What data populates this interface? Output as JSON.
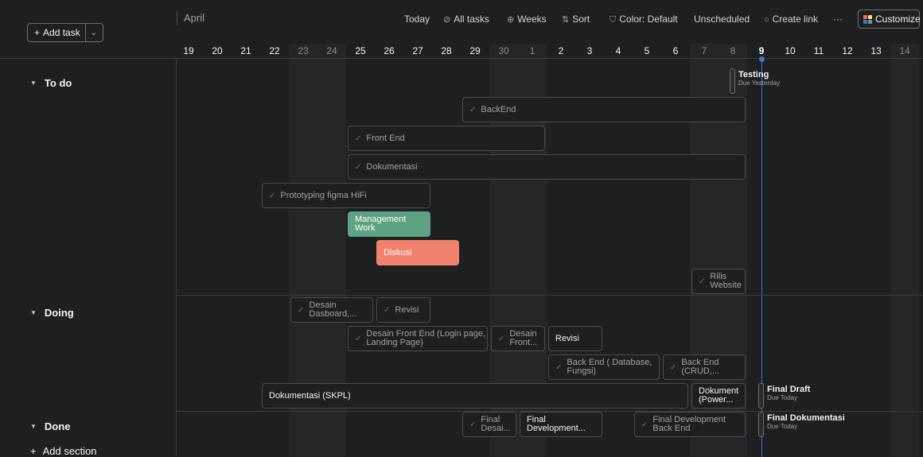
{
  "toolbar": {
    "add_task": "Add task",
    "month": "April",
    "today": "Today",
    "all_tasks": "All tasks",
    "weeks": "Weeks",
    "sort": "Sort",
    "color": "Color: Default",
    "unscheduled": "Unscheduled",
    "create_link": "Create link",
    "more": "···",
    "customize": "Customize"
  },
  "days": [
    {
      "label": "19",
      "weekend": false
    },
    {
      "label": "20",
      "weekend": false
    },
    {
      "label": "21",
      "weekend": false
    },
    {
      "label": "22",
      "weekend": false
    },
    {
      "label": "23",
      "weekend": true
    },
    {
      "label": "24",
      "weekend": true
    },
    {
      "label": "25",
      "weekend": false
    },
    {
      "label": "26",
      "weekend": false
    },
    {
      "label": "27",
      "weekend": false
    },
    {
      "label": "28",
      "weekend": false
    },
    {
      "label": "29",
      "weekend": false
    },
    {
      "label": "30",
      "weekend": true
    },
    {
      "label": "1",
      "weekend": true
    },
    {
      "label": "2",
      "weekend": false
    },
    {
      "label": "3",
      "weekend": false
    },
    {
      "label": "4",
      "weekend": false
    },
    {
      "label": "5",
      "weekend": false
    },
    {
      "label": "6",
      "weekend": false
    },
    {
      "label": "7",
      "weekend": true
    },
    {
      "label": "8",
      "weekend": true
    },
    {
      "label": "9",
      "weekend": false,
      "today": true
    },
    {
      "label": "10",
      "weekend": false
    },
    {
      "label": "11",
      "weekend": false
    },
    {
      "label": "12",
      "weekend": false
    },
    {
      "label": "13",
      "weekend": false
    },
    {
      "label": "14",
      "weekend": true
    }
  ],
  "sections": {
    "todo": "To do",
    "doing": "Doing",
    "done": "Done",
    "add_section": "Add section"
  },
  "tasks": {
    "testing": {
      "title": "Testing",
      "due": "Due Yesterday"
    },
    "backend": "BackEnd",
    "front_end": "Front End",
    "dokumentasi": "Dokumentasi",
    "prototyping": "Prototyping figma HiFi",
    "management": "Management Work",
    "diskusi": "Diskusi",
    "rilis": "Rilis Website",
    "desain_dasboard": "Desain Dasboard,...",
    "revisi_1": "Revisi",
    "desain_front_end": "Desain Front End (Login page, Landing Page)",
    "desain_front_short": "Desain Front...",
    "revisi_2": "Revisi",
    "back_end_db": "Back End ( Database, Fungsi)",
    "back_end_crud": "Back End (CRUD,...",
    "dokumentasi_skpl": "Dokumentasi (SKPL)",
    "dokument_power": "Dokument (Power...",
    "final_draft": {
      "title": "Final Draft",
      "due": "Due Today"
    },
    "final_desai": "Final Desai...",
    "final_development": "Final Development...",
    "final_dev_backend": "Final Development Back End",
    "final_dokumentasi": {
      "title": "Final Dokumentasi",
      "due": "Due Today"
    }
  }
}
